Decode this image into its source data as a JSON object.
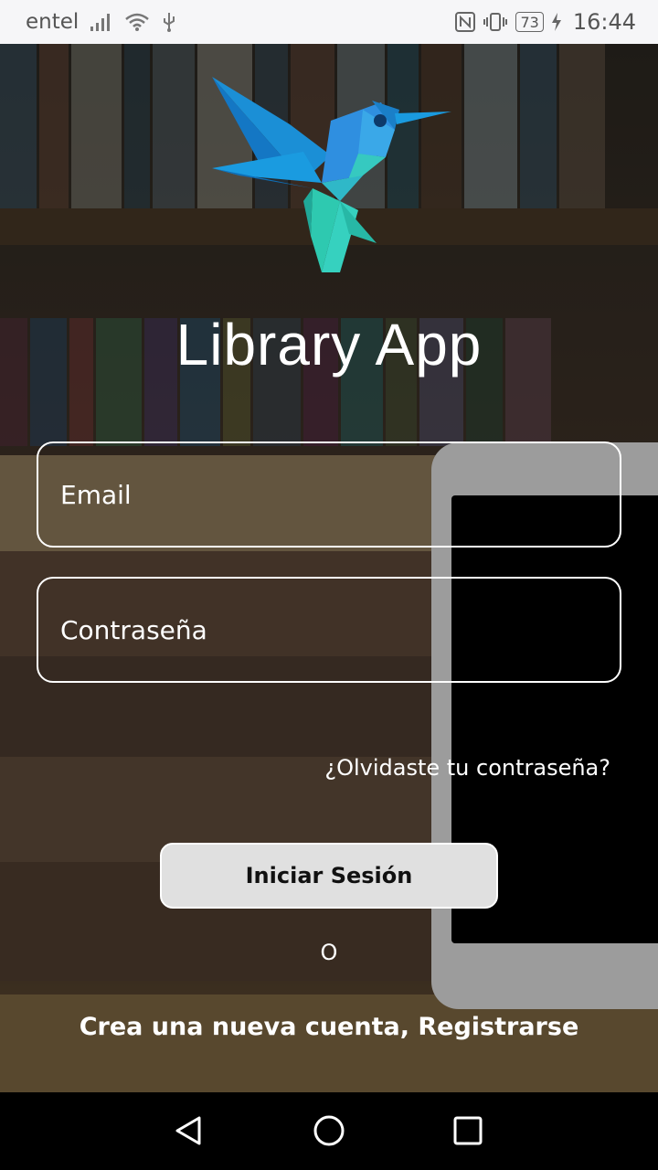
{
  "status_bar": {
    "carrier": "entel",
    "battery": "73",
    "time": "16:44",
    "icons": [
      "signal-icon",
      "wifi-icon",
      "usb-icon",
      "nfc-icon",
      "vibrate-icon",
      "battery-icon",
      "charging-icon"
    ]
  },
  "app": {
    "title": "Library App"
  },
  "form": {
    "email_placeholder": "Email",
    "password_placeholder": "Contraseña",
    "forgot_password": "¿Olvidaste tu contraseña?",
    "login_button": "Iniciar Sesión",
    "or_separator": "O",
    "register_link": "Crea una nueva cuenta, Registrarse"
  },
  "navigation": {
    "buttons": [
      "back-icon",
      "home-icon",
      "recents-icon"
    ]
  },
  "colors": {
    "logo_blue": "#1a9be0",
    "logo_teal": "#2fd1c0",
    "button_bg": "#e0e0e0"
  }
}
